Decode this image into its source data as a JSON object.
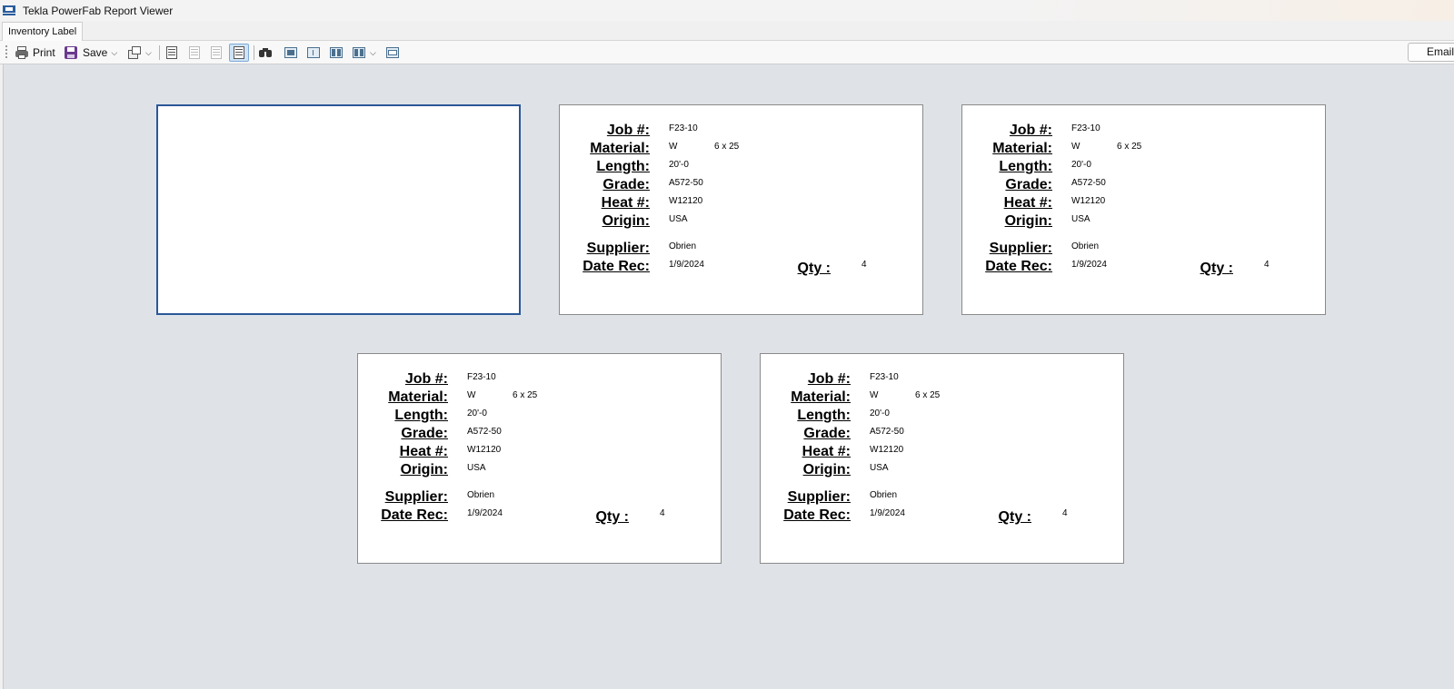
{
  "window": {
    "title": "Tekla PowerFab Report Viewer"
  },
  "tabs": [
    {
      "label": "Inventory Label"
    }
  ],
  "toolbar": {
    "print_label": "Print",
    "save_label": "Save",
    "email_label": "Email I"
  },
  "label_fields": {
    "job": "Job #:",
    "material": "Material:",
    "length": "Length:",
    "grade": "Grade:",
    "heat": "Heat #:",
    "origin": "Origin:",
    "supplier": "Supplier:",
    "date_rec": "Date Rec:",
    "qty": "Qty :"
  },
  "labels": [
    {
      "blank": true
    },
    {
      "job": "F23-10",
      "material_shape": "W",
      "material_size": "6 x 25",
      "length": "20'-0",
      "grade": "A572-50",
      "heat": "W12120",
      "origin": "USA",
      "supplier": "Obrien",
      "date_rec": "1/9/2024",
      "qty": "4"
    },
    {
      "job": "F23-10",
      "material_shape": "W",
      "material_size": "6 x 25",
      "length": "20'-0",
      "grade": "A572-50",
      "heat": "W12120",
      "origin": "USA",
      "supplier": "Obrien",
      "date_rec": "1/9/2024",
      "qty": "4"
    },
    {
      "job": "F23-10",
      "material_shape": "W",
      "material_size": "6 x 25",
      "length": "20'-0",
      "grade": "A572-50",
      "heat": "W12120",
      "origin": "USA",
      "supplier": "Obrien",
      "date_rec": "1/9/2024",
      "qty": "4"
    },
    {
      "job": "F23-10",
      "material_shape": "W",
      "material_size": "6 x 25",
      "length": "20'-0",
      "grade": "A572-50",
      "heat": "W12120",
      "origin": "USA",
      "supplier": "Obrien",
      "date_rec": "1/9/2024",
      "qty": "4"
    }
  ]
}
